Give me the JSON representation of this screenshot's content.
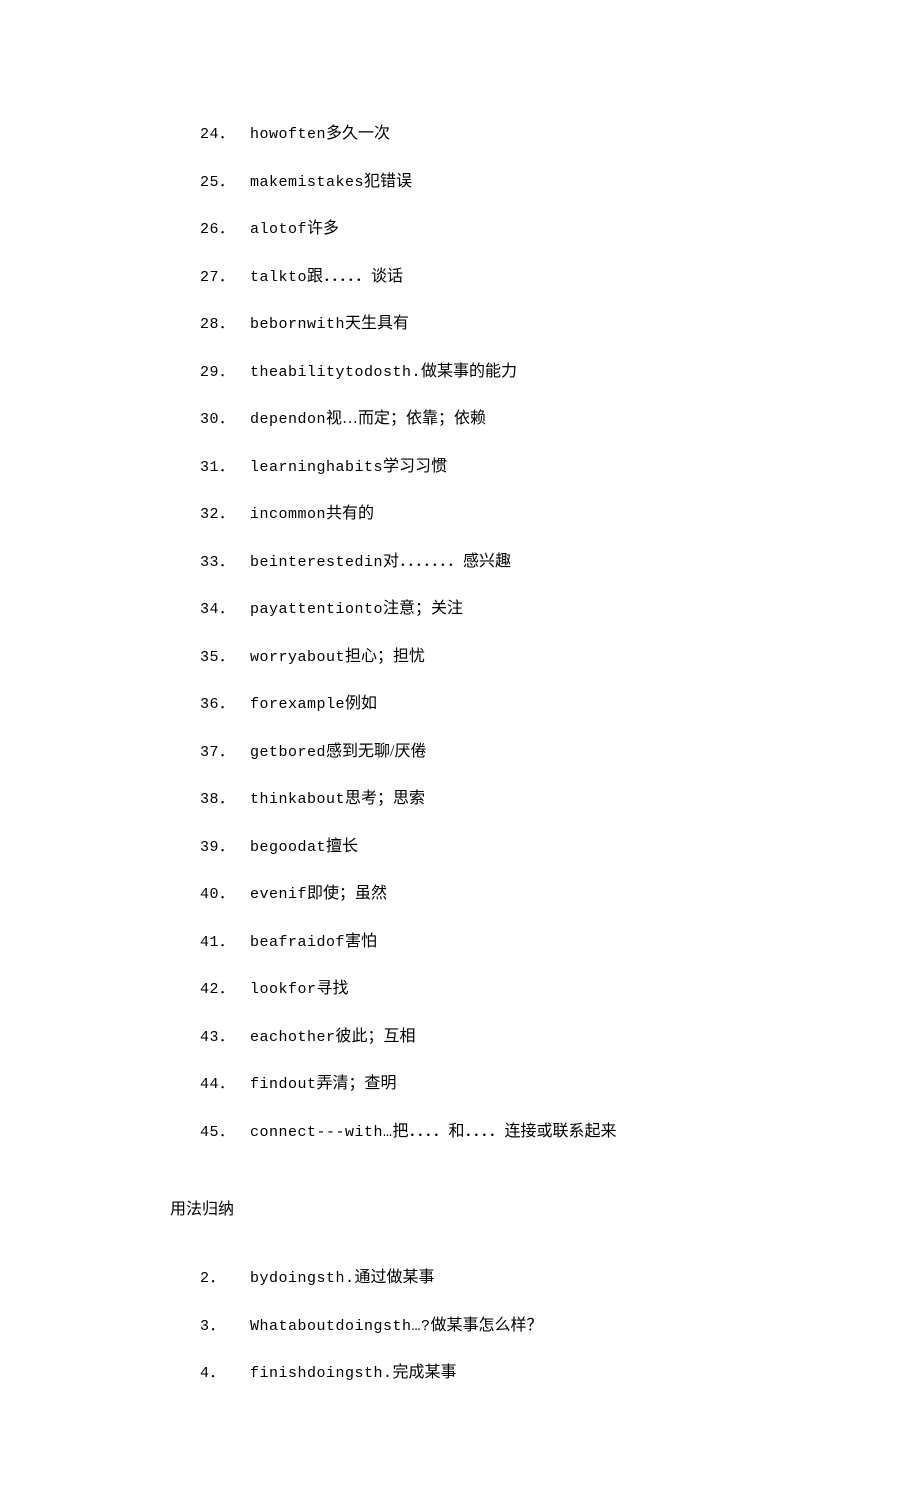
{
  "vocab_list": [
    {
      "num": "24．",
      "en": "howoften",
      "zh": "多久一次"
    },
    {
      "num": "25．",
      "en": "makemistakes",
      "zh": "犯错误"
    },
    {
      "num": "26．",
      "en": "alotof",
      "zh": "许多"
    },
    {
      "num": "27．",
      "en": "talkto",
      "zh": "跟．．．．．谈话"
    },
    {
      "num": "28．",
      "en": "bebornwith",
      "zh": "天生具有"
    },
    {
      "num": "29．",
      "en": "theabilitytodosth.",
      "zh": "做某事的能力"
    },
    {
      "num": "30．",
      "en": "dependon",
      "zh": "视…而定；依靠；依赖"
    },
    {
      "num": "31．",
      "en": "learninghabits",
      "zh": "学习习惯"
    },
    {
      "num": "32．",
      "en": "incommon",
      "zh": "共有的"
    },
    {
      "num": "33．",
      "en": "beinterestedin",
      "zh": "对．．．．．．．感兴趣"
    },
    {
      "num": "34．",
      "en": "payattentionto",
      "zh": "注意；关注"
    },
    {
      "num": "35．",
      "en": "worryabout",
      "zh": "担心；担忧"
    },
    {
      "num": "36．",
      "en": "forexample",
      "zh": "例如"
    },
    {
      "num": "37．",
      "en": "getbored",
      "zh": "感到无聊/厌倦"
    },
    {
      "num": "38．",
      "en": "thinkabout",
      "zh": "思考；思索"
    },
    {
      "num": "39．",
      "en": "begoodat",
      "zh": "擅长"
    },
    {
      "num": "40．",
      "en": "evenif",
      "zh": "即使；虽然"
    },
    {
      "num": "41．",
      "en": "beafraidof",
      "zh": "害怕"
    },
    {
      "num": "42．",
      "en": "lookfor",
      "zh": "寻找"
    },
    {
      "num": "43．",
      "en": "eachother",
      "zh": "彼此；互相"
    },
    {
      "num": "44．",
      "en": "findout",
      "zh": "弄清；查明"
    },
    {
      "num": "45．",
      "en": "connect---with…",
      "zh": "把．．．．和．．．．连接或联系起来"
    }
  ],
  "section_title": "用法归纳",
  "usage_list": [
    {
      "num": "2．",
      "en": "bydoingsth.",
      "zh": "通过做某事"
    },
    {
      "num": "3．",
      "en": "Whataboutdoingsth…?",
      "zh": "做某事怎么样？"
    },
    {
      "num": "4．",
      "en": "finishdoingsth.",
      "zh": "完成某事"
    }
  ]
}
